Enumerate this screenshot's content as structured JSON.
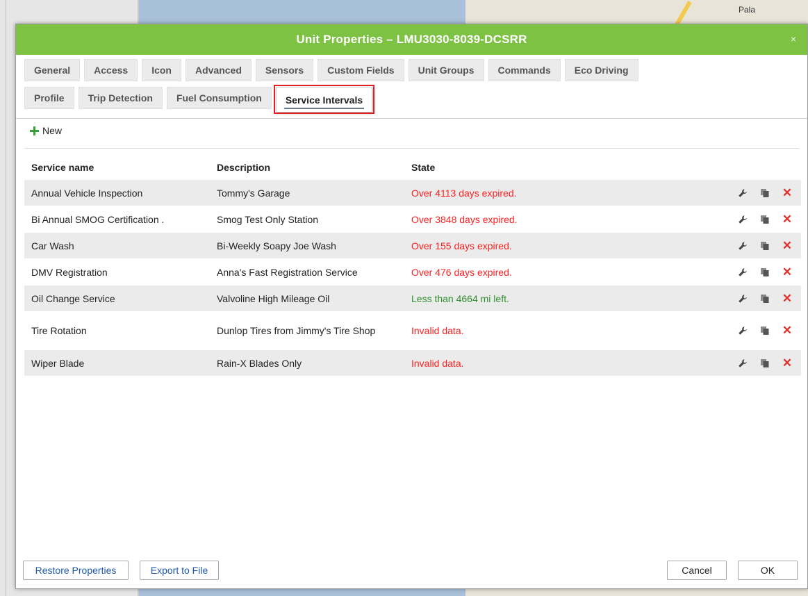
{
  "map": {
    "label": "Pala"
  },
  "dialog": {
    "title": "Unit Properties – LMU3030-8039-DCSRR",
    "close": "×"
  },
  "tabs": {
    "row1": [
      "General",
      "Access",
      "Icon",
      "Advanced",
      "Sensors",
      "Custom Fields",
      "Unit Groups",
      "Commands",
      "Eco Driving"
    ],
    "row2": [
      "Profile",
      "Trip Detection",
      "Fuel Consumption",
      "Service Intervals"
    ],
    "active": "Service Intervals"
  },
  "toolbar": {
    "new_label": "New"
  },
  "table": {
    "headers": {
      "name": "Service name",
      "description": "Description",
      "state": "State"
    },
    "rows": [
      {
        "name": "Annual Vehicle Inspection",
        "description": "Tommy's Garage",
        "state": "Over 4113 days expired.",
        "status": "expired"
      },
      {
        "name": "Bi Annual SMOG Certification .",
        "description": "Smog Test Only Station",
        "state": "Over 3848 days expired.",
        "status": "expired"
      },
      {
        "name": "Car Wash",
        "description": "Bi-Weekly Soapy Joe Wash",
        "state": "Over 155 days expired.",
        "status": "expired"
      },
      {
        "name": "DMV Registration",
        "description": "Anna's Fast Registration Service",
        "state": "Over 476 days expired.",
        "status": "expired"
      },
      {
        "name": "Oil Change Service",
        "description": "Valvoline High Mileage Oil",
        "state": "Less than 4664 mi left.",
        "status": "ok"
      },
      {
        "name": "Tire Rotation",
        "description": "Dunlop Tires from Jimmy's Tire Shop",
        "state": "Invalid data.",
        "status": "invalid"
      },
      {
        "name": "Wiper Blade",
        "description": "Rain-X Blades Only",
        "state": "Invalid data.",
        "status": "invalid"
      }
    ]
  },
  "footer": {
    "restore": "Restore Properties",
    "export": "Export to File",
    "cancel": "Cancel",
    "ok": "OK"
  },
  "colors": {
    "title_bar": "#7dc243",
    "expired": "#ff2020",
    "ok": "#2f8f2f",
    "highlight": "#e01f25",
    "link": "#1f5aa6"
  },
  "icons": {
    "add": "plus-icon",
    "edit": "wrench-icon",
    "copy": "copy-icon",
    "delete": "delete-icon",
    "close": "close-icon"
  }
}
